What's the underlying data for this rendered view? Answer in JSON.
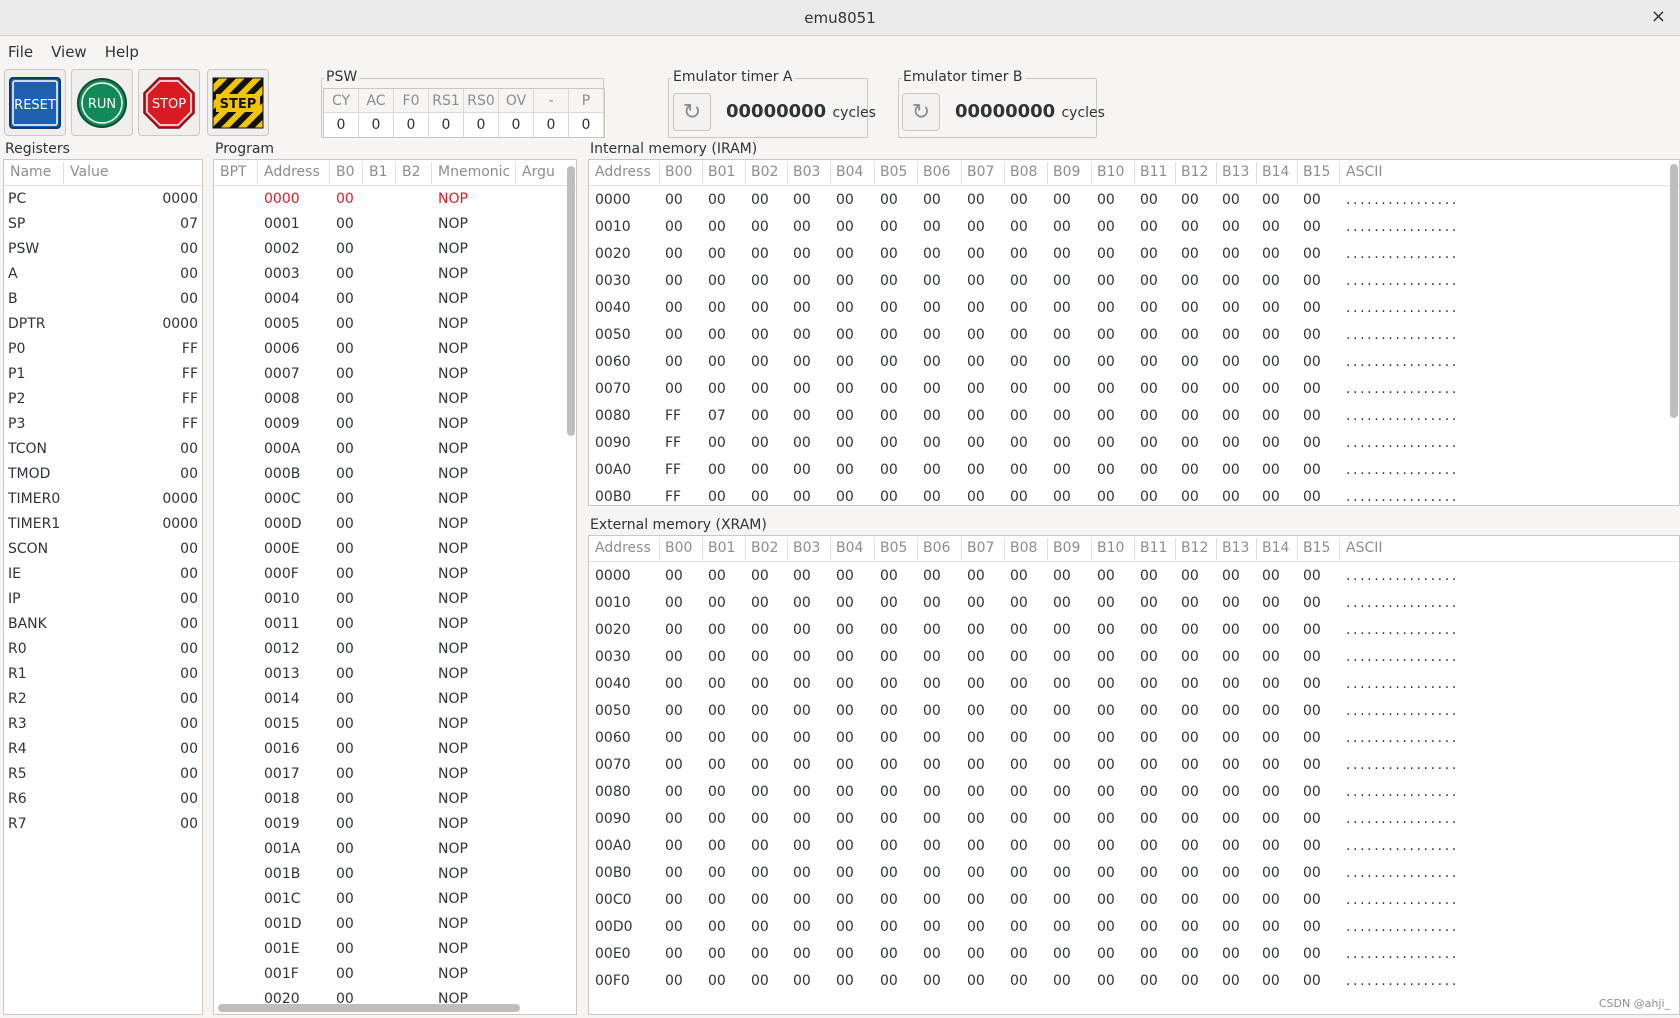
{
  "window": {
    "title": "emu8051",
    "close": "×"
  },
  "menu": [
    "File",
    "View",
    "Help"
  ],
  "toolbar": {
    "reset": "RESET",
    "run": "RUN",
    "stop": "STOP",
    "step": "STEP"
  },
  "psw": {
    "label": "PSW",
    "headers": [
      "CY",
      "AC",
      "F0",
      "RS1",
      "RS0",
      "OV",
      "-",
      "P"
    ],
    "values": [
      "0",
      "0",
      "0",
      "0",
      "0",
      "0",
      "0",
      "0"
    ]
  },
  "timerA": {
    "label": "Emulator timer A",
    "value": "00000000",
    "unit": "cycles"
  },
  "timerB": {
    "label": "Emulator timer B",
    "value": "00000000",
    "unit": "cycles"
  },
  "registers": {
    "label": "Registers",
    "headers": [
      "Name",
      "Value"
    ],
    "rows": [
      [
        "PC",
        "0000"
      ],
      [
        "SP",
        "07"
      ],
      [
        "PSW",
        "00"
      ],
      [
        "A",
        "00"
      ],
      [
        "B",
        "00"
      ],
      [
        "DPTR",
        "0000"
      ],
      [
        "P0",
        "FF"
      ],
      [
        "P1",
        "FF"
      ],
      [
        "P2",
        "FF"
      ],
      [
        "P3",
        "FF"
      ],
      [
        "TCON",
        "00"
      ],
      [
        "TMOD",
        "00"
      ],
      [
        "TIMER0",
        "0000"
      ],
      [
        "TIMER1",
        "0000"
      ],
      [
        "SCON",
        "00"
      ],
      [
        "IE",
        "00"
      ],
      [
        "IP",
        "00"
      ],
      [
        "BANK",
        "00"
      ],
      [
        "R0",
        "00"
      ],
      [
        "R1",
        "00"
      ],
      [
        "R2",
        "00"
      ],
      [
        "R3",
        "00"
      ],
      [
        "R4",
        "00"
      ],
      [
        "R5",
        "00"
      ],
      [
        "R6",
        "00"
      ],
      [
        "R7",
        "00"
      ]
    ]
  },
  "program": {
    "label": "Program",
    "headers": [
      "BPT",
      "Address",
      "B0",
      "B1",
      "B2",
      "Mnemonic",
      "Argu"
    ],
    "rows": [
      [
        "0000",
        "00",
        "NOP"
      ],
      [
        "0001",
        "00",
        "NOP"
      ],
      [
        "0002",
        "00",
        "NOP"
      ],
      [
        "0003",
        "00",
        "NOP"
      ],
      [
        "0004",
        "00",
        "NOP"
      ],
      [
        "0005",
        "00",
        "NOP"
      ],
      [
        "0006",
        "00",
        "NOP"
      ],
      [
        "0007",
        "00",
        "NOP"
      ],
      [
        "0008",
        "00",
        "NOP"
      ],
      [
        "0009",
        "00",
        "NOP"
      ],
      [
        "000A",
        "00",
        "NOP"
      ],
      [
        "000B",
        "00",
        "NOP"
      ],
      [
        "000C",
        "00",
        "NOP"
      ],
      [
        "000D",
        "00",
        "NOP"
      ],
      [
        "000E",
        "00",
        "NOP"
      ],
      [
        "000F",
        "00",
        "NOP"
      ],
      [
        "0010",
        "00",
        "NOP"
      ],
      [
        "0011",
        "00",
        "NOP"
      ],
      [
        "0012",
        "00",
        "NOP"
      ],
      [
        "0013",
        "00",
        "NOP"
      ],
      [
        "0014",
        "00",
        "NOP"
      ],
      [
        "0015",
        "00",
        "NOP"
      ],
      [
        "0016",
        "00",
        "NOP"
      ],
      [
        "0017",
        "00",
        "NOP"
      ],
      [
        "0018",
        "00",
        "NOP"
      ],
      [
        "0019",
        "00",
        "NOP"
      ],
      [
        "001A",
        "00",
        "NOP"
      ],
      [
        "001B",
        "00",
        "NOP"
      ],
      [
        "001C",
        "00",
        "NOP"
      ],
      [
        "001D",
        "00",
        "NOP"
      ],
      [
        "001E",
        "00",
        "NOP"
      ],
      [
        "001F",
        "00",
        "NOP"
      ],
      [
        "0020",
        "00",
        "NOP"
      ]
    ]
  },
  "iram": {
    "label": "Internal memory (IRAM)",
    "headers": [
      "Address",
      "B00",
      "B01",
      "B02",
      "B03",
      "B04",
      "B05",
      "B06",
      "B07",
      "B08",
      "B09",
      "B10",
      "B11",
      "B12",
      "B13",
      "B14",
      "B15",
      "ASCII"
    ],
    "rows": [
      [
        "0000",
        "00",
        "00",
        "00",
        "00",
        "00",
        "00",
        "00",
        "00",
        "00",
        "00",
        "00",
        "00",
        "00",
        "00",
        "00",
        "00",
        "................"
      ],
      [
        "0010",
        "00",
        "00",
        "00",
        "00",
        "00",
        "00",
        "00",
        "00",
        "00",
        "00",
        "00",
        "00",
        "00",
        "00",
        "00",
        "00",
        "................"
      ],
      [
        "0020",
        "00",
        "00",
        "00",
        "00",
        "00",
        "00",
        "00",
        "00",
        "00",
        "00",
        "00",
        "00",
        "00",
        "00",
        "00",
        "00",
        "................"
      ],
      [
        "0030",
        "00",
        "00",
        "00",
        "00",
        "00",
        "00",
        "00",
        "00",
        "00",
        "00",
        "00",
        "00",
        "00",
        "00",
        "00",
        "00",
        "................"
      ],
      [
        "0040",
        "00",
        "00",
        "00",
        "00",
        "00",
        "00",
        "00",
        "00",
        "00",
        "00",
        "00",
        "00",
        "00",
        "00",
        "00",
        "00",
        "................"
      ],
      [
        "0050",
        "00",
        "00",
        "00",
        "00",
        "00",
        "00",
        "00",
        "00",
        "00",
        "00",
        "00",
        "00",
        "00",
        "00",
        "00",
        "00",
        "................"
      ],
      [
        "0060",
        "00",
        "00",
        "00",
        "00",
        "00",
        "00",
        "00",
        "00",
        "00",
        "00",
        "00",
        "00",
        "00",
        "00",
        "00",
        "00",
        "................"
      ],
      [
        "0070",
        "00",
        "00",
        "00",
        "00",
        "00",
        "00",
        "00",
        "00",
        "00",
        "00",
        "00",
        "00",
        "00",
        "00",
        "00",
        "00",
        "................"
      ],
      [
        "0080",
        "FF",
        "07",
        "00",
        "00",
        "00",
        "00",
        "00",
        "00",
        "00",
        "00",
        "00",
        "00",
        "00",
        "00",
        "00",
        "00",
        "................"
      ],
      [
        "0090",
        "FF",
        "00",
        "00",
        "00",
        "00",
        "00",
        "00",
        "00",
        "00",
        "00",
        "00",
        "00",
        "00",
        "00",
        "00",
        "00",
        "................"
      ],
      [
        "00A0",
        "FF",
        "00",
        "00",
        "00",
        "00",
        "00",
        "00",
        "00",
        "00",
        "00",
        "00",
        "00",
        "00",
        "00",
        "00",
        "00",
        "................"
      ],
      [
        "00B0",
        "FF",
        "00",
        "00",
        "00",
        "00",
        "00",
        "00",
        "00",
        "00",
        "00",
        "00",
        "00",
        "00",
        "00",
        "00",
        "00",
        "................"
      ]
    ]
  },
  "xram": {
    "label": "External memory (XRAM)",
    "headers": [
      "Address",
      "B00",
      "B01",
      "B02",
      "B03",
      "B04",
      "B05",
      "B06",
      "B07",
      "B08",
      "B09",
      "B10",
      "B11",
      "B12",
      "B13",
      "B14",
      "B15",
      "ASCII"
    ],
    "rows": [
      [
        "0000",
        "00",
        "00",
        "00",
        "00",
        "00",
        "00",
        "00",
        "00",
        "00",
        "00",
        "00",
        "00",
        "00",
        "00",
        "00",
        "00",
        "................"
      ],
      [
        "0010",
        "00",
        "00",
        "00",
        "00",
        "00",
        "00",
        "00",
        "00",
        "00",
        "00",
        "00",
        "00",
        "00",
        "00",
        "00",
        "00",
        "................"
      ],
      [
        "0020",
        "00",
        "00",
        "00",
        "00",
        "00",
        "00",
        "00",
        "00",
        "00",
        "00",
        "00",
        "00",
        "00",
        "00",
        "00",
        "00",
        "................"
      ],
      [
        "0030",
        "00",
        "00",
        "00",
        "00",
        "00",
        "00",
        "00",
        "00",
        "00",
        "00",
        "00",
        "00",
        "00",
        "00",
        "00",
        "00",
        "................"
      ],
      [
        "0040",
        "00",
        "00",
        "00",
        "00",
        "00",
        "00",
        "00",
        "00",
        "00",
        "00",
        "00",
        "00",
        "00",
        "00",
        "00",
        "00",
        "................"
      ],
      [
        "0050",
        "00",
        "00",
        "00",
        "00",
        "00",
        "00",
        "00",
        "00",
        "00",
        "00",
        "00",
        "00",
        "00",
        "00",
        "00",
        "00",
        "................"
      ],
      [
        "0060",
        "00",
        "00",
        "00",
        "00",
        "00",
        "00",
        "00",
        "00",
        "00",
        "00",
        "00",
        "00",
        "00",
        "00",
        "00",
        "00",
        "................"
      ],
      [
        "0070",
        "00",
        "00",
        "00",
        "00",
        "00",
        "00",
        "00",
        "00",
        "00",
        "00",
        "00",
        "00",
        "00",
        "00",
        "00",
        "00",
        "................"
      ],
      [
        "0080",
        "00",
        "00",
        "00",
        "00",
        "00",
        "00",
        "00",
        "00",
        "00",
        "00",
        "00",
        "00",
        "00",
        "00",
        "00",
        "00",
        "................"
      ],
      [
        "0090",
        "00",
        "00",
        "00",
        "00",
        "00",
        "00",
        "00",
        "00",
        "00",
        "00",
        "00",
        "00",
        "00",
        "00",
        "00",
        "00",
        "................"
      ],
      [
        "00A0",
        "00",
        "00",
        "00",
        "00",
        "00",
        "00",
        "00",
        "00",
        "00",
        "00",
        "00",
        "00",
        "00",
        "00",
        "00",
        "00",
        "................"
      ],
      [
        "00B0",
        "00",
        "00",
        "00",
        "00",
        "00",
        "00",
        "00",
        "00",
        "00",
        "00",
        "00",
        "00",
        "00",
        "00",
        "00",
        "00",
        "................"
      ],
      [
        "00C0",
        "00",
        "00",
        "00",
        "00",
        "00",
        "00",
        "00",
        "00",
        "00",
        "00",
        "00",
        "00",
        "00",
        "00",
        "00",
        "00",
        "................"
      ],
      [
        "00D0",
        "00",
        "00",
        "00",
        "00",
        "00",
        "00",
        "00",
        "00",
        "00",
        "00",
        "00",
        "00",
        "00",
        "00",
        "00",
        "00",
        "................"
      ],
      [
        "00E0",
        "00",
        "00",
        "00",
        "00",
        "00",
        "00",
        "00",
        "00",
        "00",
        "00",
        "00",
        "00",
        "00",
        "00",
        "00",
        "00",
        "................"
      ],
      [
        "00F0",
        "00",
        "00",
        "00",
        "00",
        "00",
        "00",
        "00",
        "00",
        "00",
        "00",
        "00",
        "00",
        "00",
        "00",
        "00",
        "00",
        "................"
      ]
    ]
  },
  "watermark": "CSDN @ahji_",
  "colors": {
    "highlight": "#e01b24",
    "reset": "#1f5fb0",
    "run": "#118a57",
    "stop": "#d91a22",
    "step_yellow": "#f2c500"
  }
}
